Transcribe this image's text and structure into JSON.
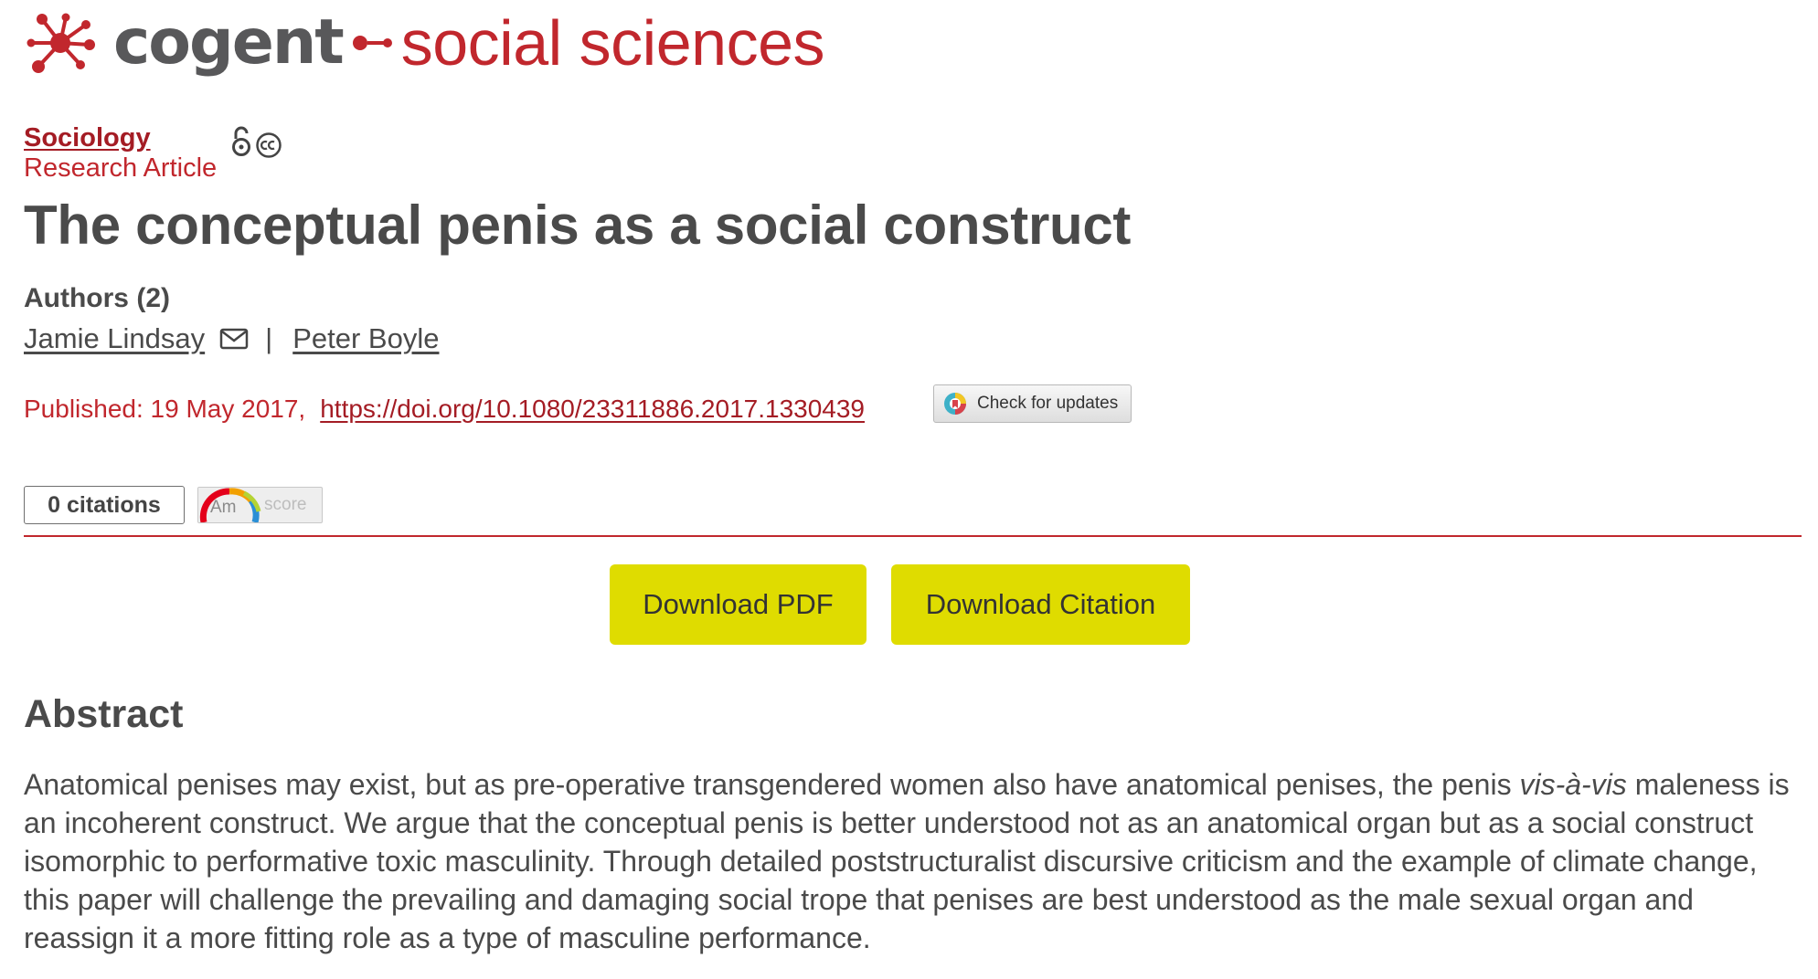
{
  "brand": {
    "name_part1": "cogent",
    "name_part2": "social sciences",
    "brand_red": "#c1272d",
    "brand_grey": "#58585a",
    "logo_icon": "molecule-logo-icon"
  },
  "article": {
    "subject": "Sociology",
    "type": "Research Article",
    "access_icons": [
      "open-access-icon",
      "creative-commons-icon"
    ],
    "title": "The conceptual penis as a social construct",
    "authors_heading": "Authors (2)",
    "authors": [
      {
        "name": "Jamie Lindsay",
        "has_email": true
      },
      {
        "name": "Peter Boyle",
        "has_email": false
      }
    ],
    "author_separator": "|",
    "published_label": "Published: 19 May 2017,",
    "doi": "https://doi.org/10.1080/23311886.2017.1330439",
    "check_updates_label": "Check for updates"
  },
  "metrics": {
    "citations_label": "0 citations",
    "altmetric_am": "Am",
    "altmetric_score": "score"
  },
  "actions": {
    "download_pdf": "Download PDF",
    "download_citation": "Download Citation",
    "button_color": "#dfdc00"
  },
  "abstract": {
    "heading": "Abstract",
    "text_before_italic": "Anatomical penises may exist, but as pre-operative transgendered women also have anatomical penises, the penis ",
    "italic": "vis-à-vis",
    "text_after_italic": " maleness is an incoherent construct. We argue that the conceptual penis is better understood not as an anatomical organ but as a social construct isomorphic to performative toxic masculinity. Through detailed poststructuralist discursive criticism and the example of climate change, this paper will challenge the prevailing and damaging social trope that penises are best understood as the male sexual organ and reassign it a more fitting role as a type of masculine performance."
  }
}
